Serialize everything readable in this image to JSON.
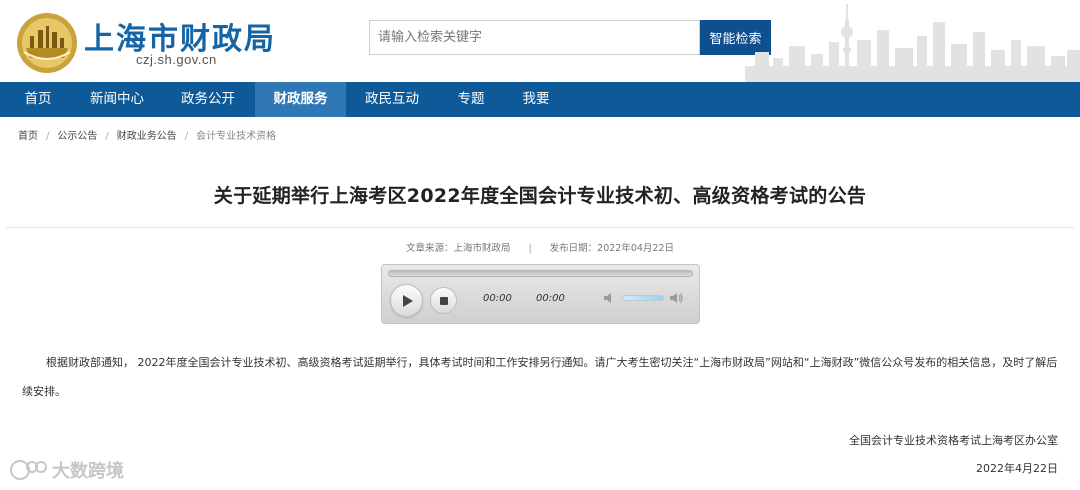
{
  "header": {
    "site_title": "上海市财政局",
    "domain": "czj.sh.gov.cn",
    "search_placeholder": "请输入检索关键字",
    "search_button": "智能检索"
  },
  "nav": {
    "items": [
      {
        "label": "首页",
        "active": false
      },
      {
        "label": "新闻中心",
        "active": false
      },
      {
        "label": "政务公开",
        "active": false
      },
      {
        "label": "财政服务",
        "active": true
      },
      {
        "label": "政民互动",
        "active": false
      },
      {
        "label": "专题",
        "active": false
      },
      {
        "label": "我要",
        "active": false
      }
    ]
  },
  "breadcrumb": [
    "首页",
    "公示公告",
    "财政业务公告",
    "会计专业技术资格"
  ],
  "article": {
    "title": "关于延期举行上海考区2022年度全国会计专业技术初、高级资格考试的公告",
    "source": "文章来源：上海市财政局",
    "date": "发布日期：2022年04月22日",
    "meta_separator": "|",
    "body": "根据财政部通知， 2022年度全国会计专业技术初、高级资格考试延期举行，具体考试时间和工作安排另行通知。请广大考生密切关注“上海市财政局”网站和“上海财政”微信公众号发布的相关信息，及时了解后续安排。",
    "signature_office": "全国会计专业技术资格考试上海考区办公室",
    "signature_date": "2022年4月22日"
  },
  "player": {
    "current_time": "00:00",
    "duration": "00:00",
    "volume": 0.85
  },
  "watermark": "大数跨境",
  "colors": {
    "brand_blue": "#1565a6",
    "nav_bg": "#0e5a99",
    "nav_active": "#2f77b5",
    "search_button": "#0e4f8f",
    "emblem_gold": "#c9a23a"
  }
}
